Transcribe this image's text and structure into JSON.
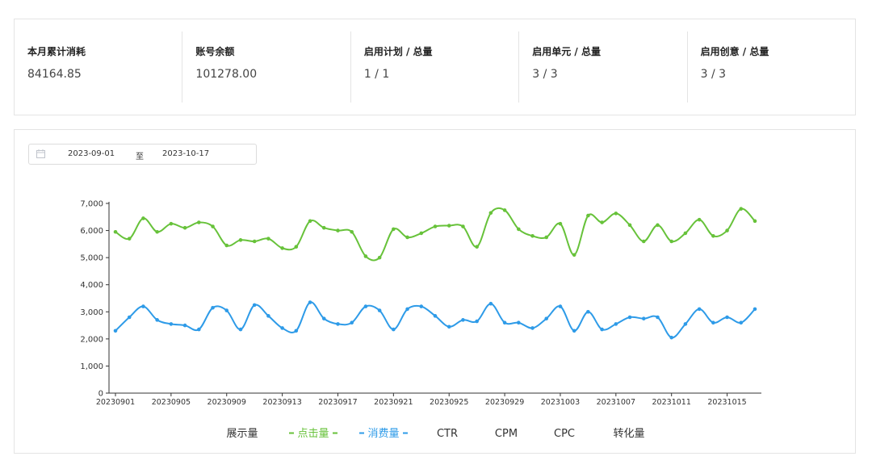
{
  "stats": [
    {
      "label": "本月累计消耗",
      "value": "84164.85"
    },
    {
      "label": "账号余额",
      "value": "101278.00"
    },
    {
      "label": "启用计划 / 总量",
      "value": "1 / 1"
    },
    {
      "label": "启用单元 / 总量",
      "value": "3 / 3"
    },
    {
      "label": "启用创意 / 总量",
      "value": "3 / 3"
    }
  ],
  "date_range": {
    "start": "2023-09-01",
    "separator": "至",
    "end": "2023-10-17"
  },
  "colors": {
    "green": "#67c23a",
    "blue": "#2e9be8",
    "axis": "#333333"
  },
  "chart_data": {
    "type": "line",
    "title": "",
    "xlabel": "",
    "ylabel": "",
    "ylim": [
      0,
      7000
    ],
    "yticks": [
      0,
      1000,
      2000,
      3000,
      4000,
      5000,
      6000,
      7000
    ],
    "ytick_labels": [
      "0",
      "1,000",
      "2,000",
      "3,000",
      "4,000",
      "5,000",
      "6,000",
      "7,000"
    ],
    "x": [
      "20230901",
      "20230902",
      "20230903",
      "20230904",
      "20230905",
      "20230906",
      "20230907",
      "20230908",
      "20230909",
      "20230910",
      "20230911",
      "20230912",
      "20230913",
      "20230914",
      "20230915",
      "20230916",
      "20230917",
      "20230918",
      "20230919",
      "20230920",
      "20230921",
      "20230922",
      "20230923",
      "20230924",
      "20230925",
      "20230926",
      "20230927",
      "20230928",
      "20230929",
      "20230930",
      "20231001",
      "20231002",
      "20231003",
      "20231004",
      "20231005",
      "20231006",
      "20231007",
      "20231008",
      "20231009",
      "20231010",
      "20231011",
      "20231012",
      "20231013",
      "20231014",
      "20231015",
      "20231016",
      "20231017"
    ],
    "xtick_labels": [
      "20230901",
      "20230905",
      "20230909",
      "20230913",
      "20230917",
      "20230921",
      "20230925",
      "20230929",
      "20231003",
      "20231007",
      "20231011",
      "20231015"
    ],
    "grid": false,
    "legend": [
      "展示量",
      "点击量",
      "消费量",
      "CTR",
      "CPM",
      "CPC",
      "转化量"
    ],
    "legend_position": "bottom",
    "series": [
      {
        "name": "点击量",
        "color": "#67c23a",
        "values": [
          5950,
          5700,
          6450,
          5950,
          6250,
          6100,
          6300,
          6150,
          5450,
          5650,
          5600,
          5700,
          5350,
          5400,
          6350,
          6100,
          6000,
          5950,
          5050,
          5000,
          6050,
          5750,
          5900,
          6150,
          6180,
          6150,
          5400,
          6650,
          6750,
          6050,
          5800,
          5750,
          6250,
          5100,
          6550,
          6300,
          6630,
          6200,
          5600,
          6200,
          5600,
          5900,
          6400,
          5800,
          6000,
          6800,
          6350
        ]
      },
      {
        "name": "消费量",
        "color": "#2e9be8",
        "values": [
          2300,
          2800,
          3200,
          2700,
          2550,
          2500,
          2350,
          3150,
          3050,
          2350,
          3250,
          2850,
          2400,
          2300,
          3350,
          2750,
          2550,
          2600,
          3200,
          3050,
          2350,
          3100,
          3200,
          2850,
          2450,
          2700,
          2650,
          3300,
          2600,
          2600,
          2400,
          2750,
          3200,
          2300,
          3000,
          2350,
          2550,
          2800,
          2750,
          2800,
          2050,
          2550,
          3100,
          2600,
          2800,
          2600,
          3100
        ]
      }
    ]
  }
}
